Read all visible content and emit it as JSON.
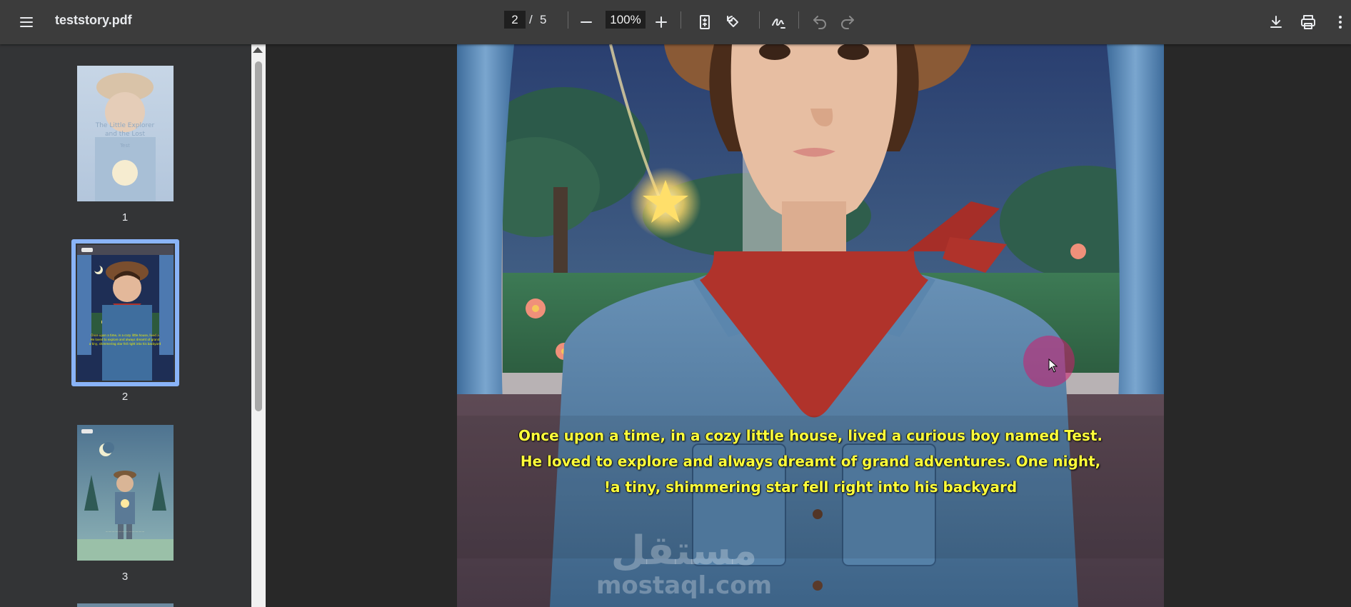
{
  "toolbar": {
    "menu_icon": "hamburger-menu-icon",
    "title": "teststory.pdf",
    "page_current": "2",
    "page_separator": "/",
    "page_total": "5",
    "zoom": "100%",
    "icons": [
      "zoom-out-icon",
      "zoom-in-icon",
      "fit-page-icon",
      "rotate-icon",
      "annotate-pen-icon",
      "undo-icon",
      "redo-icon",
      "download-icon",
      "print-icon",
      "more-options-icon"
    ]
  },
  "sidebar": {
    "thumbnails": [
      {
        "label": "1",
        "selected": false
      },
      {
        "label": "2",
        "selected": true
      },
      {
        "label": "3",
        "selected": false
      }
    ]
  },
  "page": {
    "story_lines": [
      "Once upon a time, in a cozy little house, lived a curious boy named Test.",
      "He loved to explore and always dreamt of grand adventures. One night,",
      "!a tiny, shimmering star fell right into his backyard"
    ],
    "watermark_arabic": "مستقل",
    "watermark_latin": "mostaql.com"
  },
  "colors": {
    "toolbar_bg": "#3c3c3c",
    "sidebar_bg": "#333436",
    "viewer_bg": "#282828",
    "selection": "#8ab4f8",
    "story_text": "#ffff3a"
  }
}
